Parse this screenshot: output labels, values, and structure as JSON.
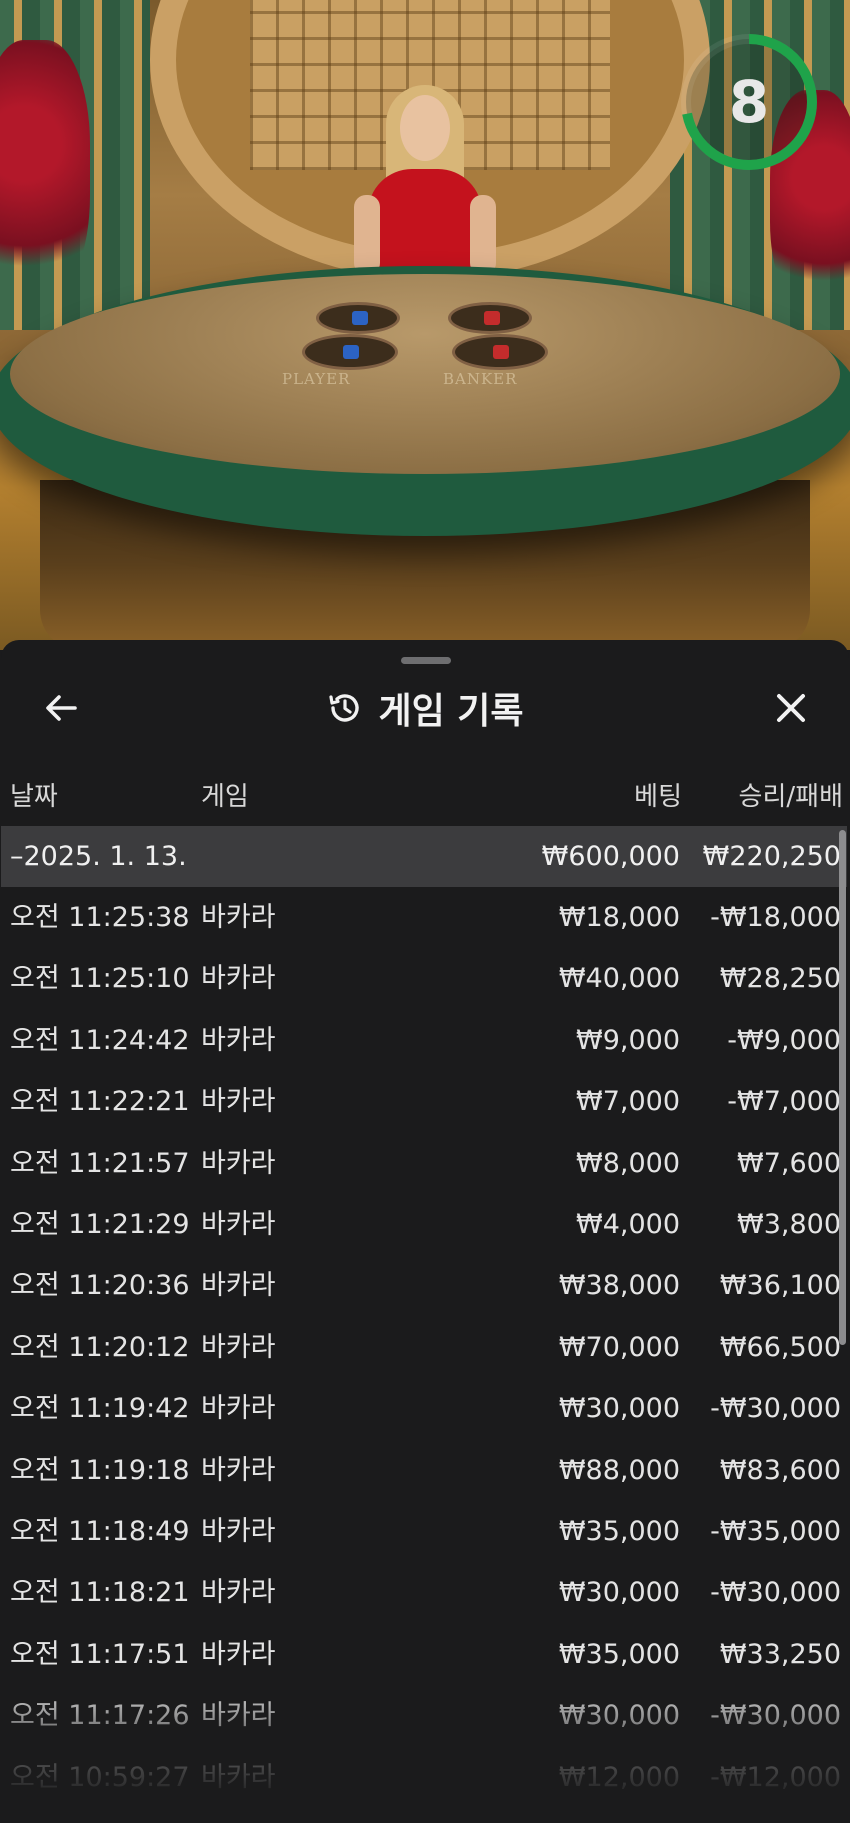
{
  "timer": {
    "value": "8",
    "progress": 0.72,
    "color": "#1fa34a"
  },
  "table": {
    "player_label": "PLAYER",
    "banker_label": "BANKER"
  },
  "panel": {
    "title": "게임 기록",
    "icons": {
      "back": "arrow-left-icon",
      "history": "history-icon",
      "close": "close-icon"
    }
  },
  "columns": {
    "date": "날짜",
    "game": "게임",
    "bet": "베팅",
    "win_loss": "승리/패배"
  },
  "summary": {
    "date": "–2025. 1. 13.",
    "bet": "₩600,000",
    "win_loss": "₩220,250"
  },
  "rows": [
    {
      "time": "오전 11:25:38",
      "game": "바카라",
      "bet": "₩18,000",
      "result": "-₩18,000"
    },
    {
      "time": "오전 11:25:10",
      "game": "바카라",
      "bet": "₩40,000",
      "result": "₩28,250"
    },
    {
      "time": "오전 11:24:42",
      "game": "바카라",
      "bet": "₩9,000",
      "result": "-₩9,000"
    },
    {
      "time": "오전 11:22:21",
      "game": "바카라",
      "bet": "₩7,000",
      "result": "-₩7,000"
    },
    {
      "time": "오전 11:21:57",
      "game": "바카라",
      "bet": "₩8,000",
      "result": "₩7,600"
    },
    {
      "time": "오전 11:21:29",
      "game": "바카라",
      "bet": "₩4,000",
      "result": "₩3,800"
    },
    {
      "time": "오전 11:20:36",
      "game": "바카라",
      "bet": "₩38,000",
      "result": "₩36,100"
    },
    {
      "time": "오전 11:20:12",
      "game": "바카라",
      "bet": "₩70,000",
      "result": "₩66,500"
    },
    {
      "time": "오전 11:19:42",
      "game": "바카라",
      "bet": "₩30,000",
      "result": "-₩30,000"
    },
    {
      "time": "오전 11:19:18",
      "game": "바카라",
      "bet": "₩88,000",
      "result": "₩83,600"
    },
    {
      "time": "오전 11:18:49",
      "game": "바카라",
      "bet": "₩35,000",
      "result": "-₩35,000"
    },
    {
      "time": "오전 11:18:21",
      "game": "바카라",
      "bet": "₩30,000",
      "result": "-₩30,000"
    },
    {
      "time": "오전 11:17:51",
      "game": "바카라",
      "bet": "₩35,000",
      "result": "₩33,250"
    },
    {
      "time": "오전 11:17:26",
      "game": "바카라",
      "bet": "₩30,000",
      "result": "-₩30,000"
    },
    {
      "time": "오전 10:59:27",
      "game": "바카라",
      "bet": "₩12,000",
      "result": "-₩12,000"
    }
  ]
}
